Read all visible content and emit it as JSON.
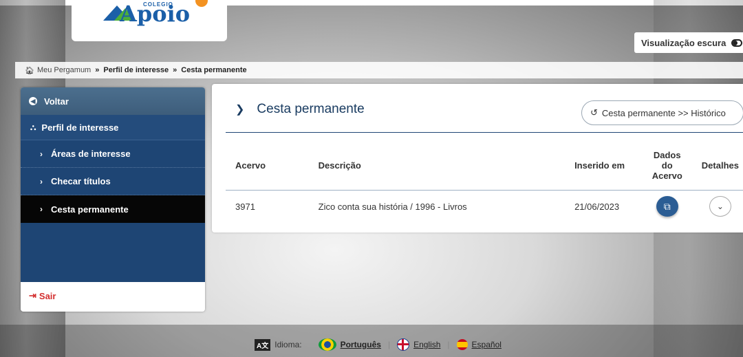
{
  "logo": {
    "subtext": "COLEGIO",
    "name": "Apoio"
  },
  "header": {
    "dark_mode_label": "Visualização escura"
  },
  "breadcrumb": {
    "items": [
      "Meu Pergamum",
      "Perfil de interesse",
      "Cesta permanente"
    ],
    "separator": "»"
  },
  "sidebar": {
    "back_label": "Voltar",
    "section_label": "Perfil de interesse",
    "items": [
      {
        "label": "Áreas de interesse",
        "active": false
      },
      {
        "label": "Checar títulos",
        "active": false
      },
      {
        "label": "Cesta permanente",
        "active": true
      }
    ],
    "exit_label": "Sair"
  },
  "main": {
    "title": "Cesta permanente",
    "history_button": "Cesta permanente >> Histórico",
    "columns": [
      "Acervo",
      "Descrição",
      "Inserido em",
      "Dados do Acervo",
      "Detalhes"
    ],
    "rows": [
      {
        "acervo": "3971",
        "descricao": "Zico conta sua história / 1996 - Livros",
        "inserido": "21/06/2023"
      }
    ]
  },
  "footer": {
    "language_label": "Idioma:",
    "languages": [
      "Português",
      "English",
      "Español"
    ],
    "current": "Português"
  },
  "colors": {
    "primary": "#1e4574",
    "active": "#060606",
    "exit": "#d32f2f",
    "accent_button": "#2b5d94"
  }
}
